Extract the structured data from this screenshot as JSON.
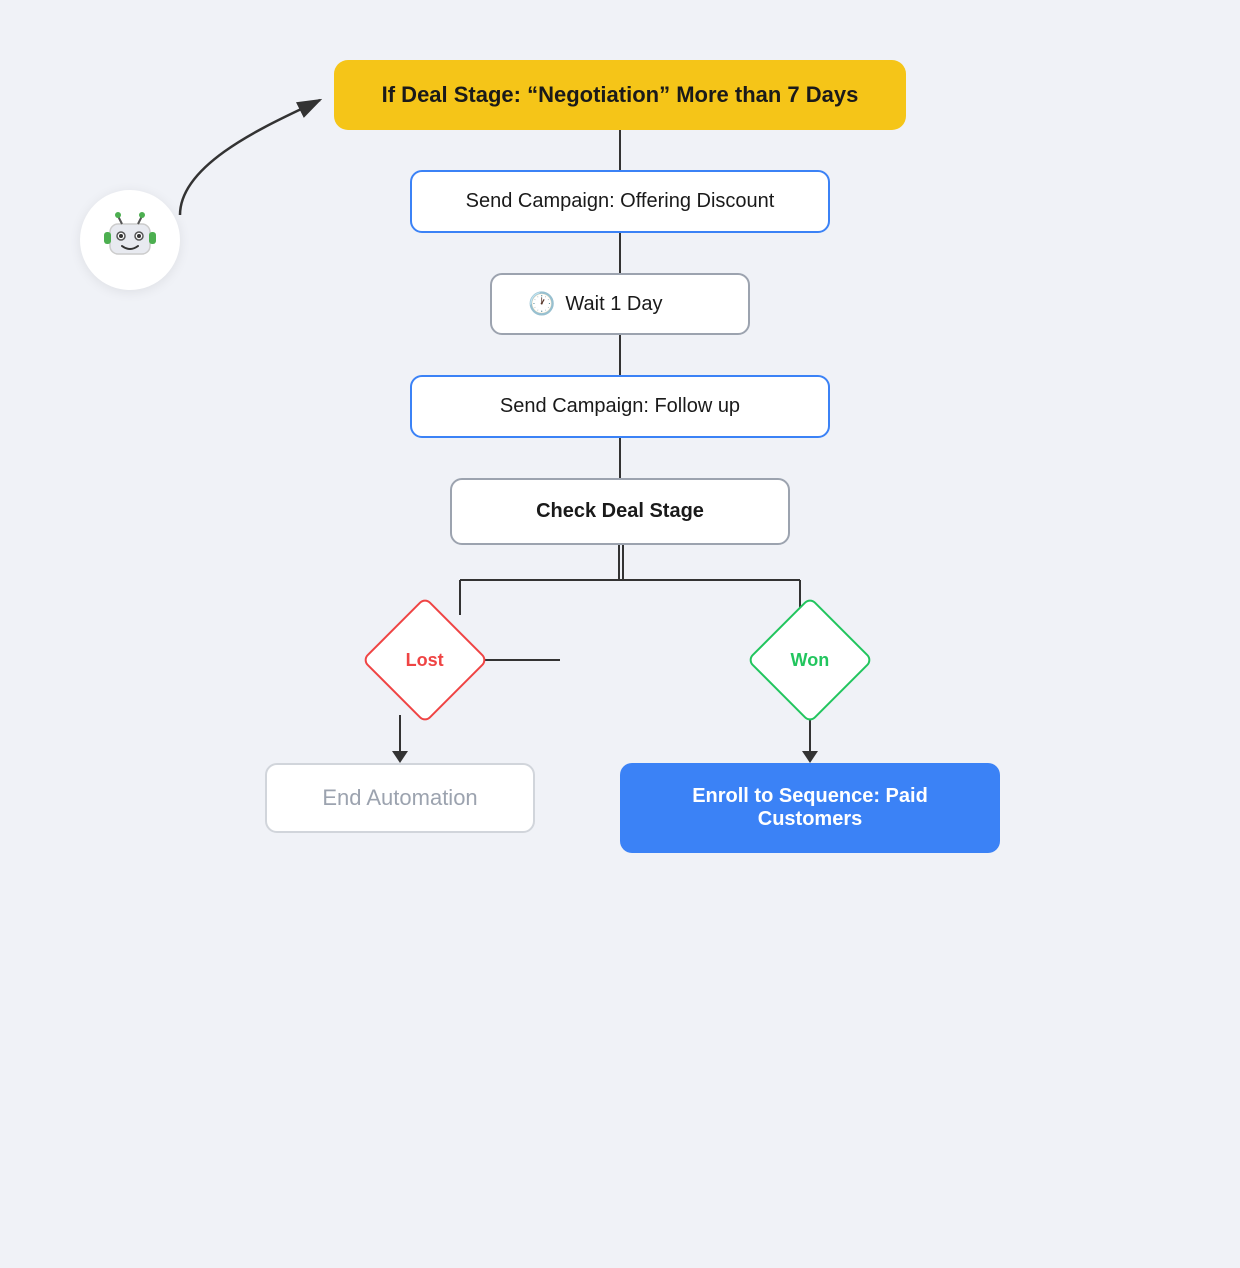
{
  "trigger": {
    "label": "If Deal Stage: “Negotiation” More than 7 Days"
  },
  "nodes": [
    {
      "id": "send-campaign-1",
      "type": "action",
      "label": "Send Campaign: Offering Discount"
    },
    {
      "id": "wait-1",
      "type": "wait",
      "label": "Wait 1 Day"
    },
    {
      "id": "send-campaign-2",
      "type": "action",
      "label": "Send Campaign: Follow up"
    },
    {
      "id": "check-deal",
      "type": "check",
      "label": "Check Deal Stage"
    }
  ],
  "branches": {
    "lost": {
      "label": "Lost"
    },
    "won": {
      "label": "Won"
    },
    "end": {
      "label": "End Automation"
    },
    "enroll": {
      "label": "Enroll to Sequence: Paid Customers"
    }
  },
  "icons": {
    "clock": "⏰",
    "robot": "robot"
  }
}
